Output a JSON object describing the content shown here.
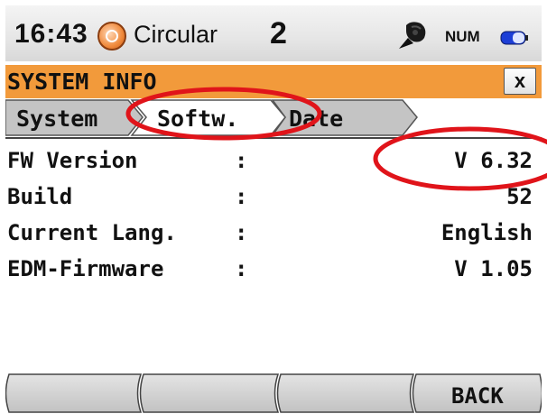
{
  "status_bar": {
    "time": "16:43",
    "mode": "Circular",
    "face": "2",
    "num": "NUM",
    "icons": [
      "target-prism-icon",
      "compensator-icon",
      "battery-icon"
    ]
  },
  "window": {
    "title": "SYSTEM INFO",
    "close_label": "x"
  },
  "tabs": [
    {
      "label": "System",
      "active": false
    },
    {
      "label": "Softw.",
      "active": true
    },
    {
      "label": "Date",
      "active": false
    }
  ],
  "rows": [
    {
      "label": "FW Version",
      "colon": ":",
      "value": "V 6.32"
    },
    {
      "label": "Build",
      "colon": ":",
      "value": "52"
    },
    {
      "label": "Current Lang.",
      "colon": ":",
      "value": "English"
    },
    {
      "label": "EDM-Firmware",
      "colon": ":",
      "value": "V 1.05"
    }
  ],
  "softkeys": [
    "",
    "",
    "",
    "BACK"
  ],
  "colors": {
    "title_bar": "#f29a3b",
    "tab_inactive": "#c4c4c4",
    "tab_active": "#ffffff",
    "annotation": "#e0141a"
  }
}
